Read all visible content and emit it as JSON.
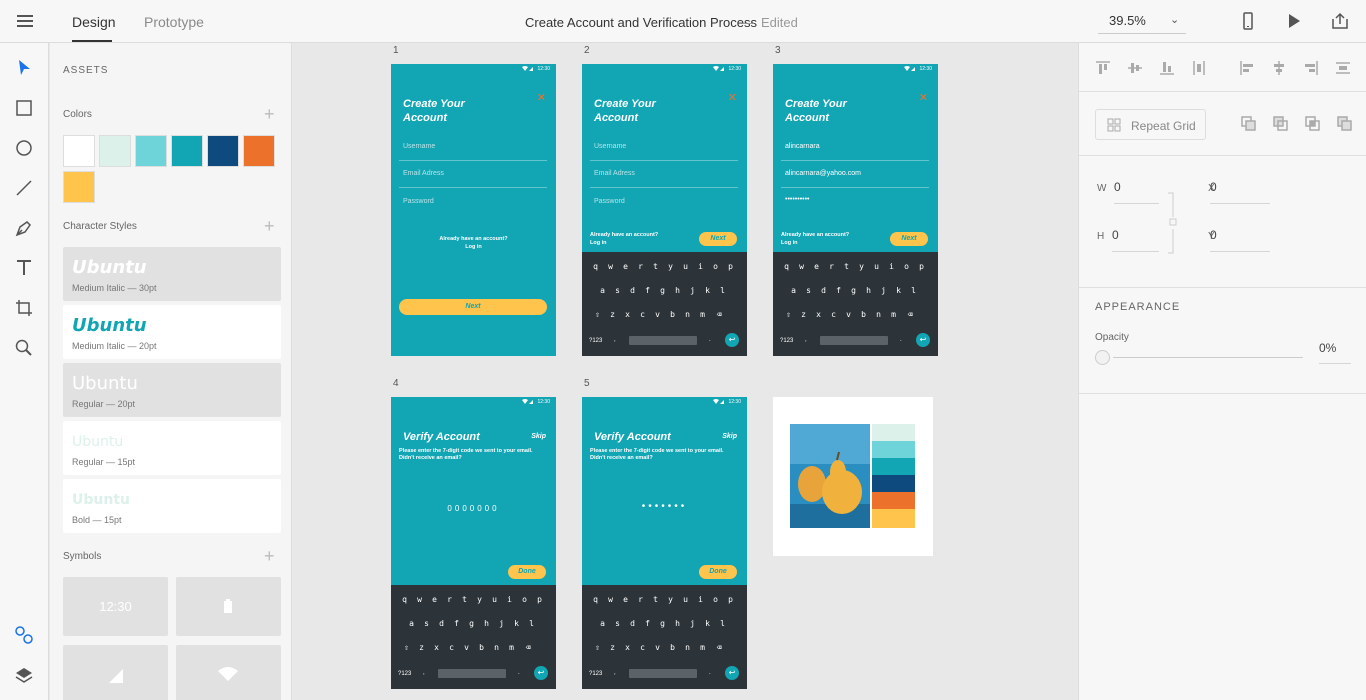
{
  "header": {
    "menu_icon": "hamburger-icon",
    "tabs": [
      {
        "label": "Design",
        "active": true
      },
      {
        "label": "Prototype",
        "active": false
      }
    ],
    "document_title": "Create Account and Verification Process",
    "separator": "—",
    "status": "Edited",
    "zoom": "39.5%",
    "icons": [
      "mobile-preview-icon",
      "play-icon",
      "share-icon"
    ]
  },
  "toolbar": {
    "tools": [
      "select-tool-icon",
      "rectangle-tool-icon",
      "ellipse-tool-icon",
      "line-tool-icon",
      "pen-tool-icon",
      "text-tool-icon",
      "artboard-tool-icon",
      "zoom-tool-icon"
    ],
    "bottom": [
      "assets-icon",
      "layers-icon"
    ]
  },
  "assets": {
    "title": "ASSETS",
    "colors_label": "Colors",
    "colors": [
      "#ffffff",
      "#dcf1ea",
      "#6fd3da",
      "#12a5b3",
      "#0e4a7e",
      "#ec722c",
      "#ffc44c"
    ],
    "character_styles_label": "Character Styles",
    "character_styles": [
      {
        "name": "Ubuntu",
        "desc": "Medium Italic — 30pt"
      },
      {
        "name": "Ubuntu",
        "desc": "Medium Italic — 20pt"
      },
      {
        "name": "Ubuntu",
        "desc": "Regular — 20pt"
      },
      {
        "name": "Ubuntu",
        "desc": "Regular — 15pt"
      },
      {
        "name": "Ubuntu",
        "desc": "Bold — 15pt"
      }
    ],
    "symbols_label": "Symbols",
    "symbols": [
      {
        "label": "12:30"
      },
      {
        "label": ""
      },
      {
        "label": ""
      },
      {
        "label": ""
      }
    ]
  },
  "artboards": {
    "numbers": [
      "1",
      "2",
      "3",
      "4",
      "5"
    ],
    "status_time": "12:30",
    "create_title_line1": "Create Your",
    "create_title_line2": "Account",
    "fields": {
      "username": "Username",
      "email": "Email Adress",
      "password": "Password",
      "username_value": "alincarnara",
      "email_value": "alincarnara@yahoo.com",
      "password_value": "••••••••••"
    },
    "already_line1": "Already have an account?",
    "already_line2": "Log in",
    "next": "Next",
    "verify_title": "Verify Account",
    "skip": "Skip",
    "verify_sub": "Please enter the 7-digit code we sent to your email. Didn't receive an email?",
    "code_empty": "0000000",
    "code_filled": "•••••••",
    "done": "Done",
    "keyboard": {
      "row1": [
        "q",
        "w",
        "e",
        "r",
        "t",
        "y",
        "u",
        "i",
        "o",
        "p"
      ],
      "row2": [
        "a",
        "s",
        "d",
        "f",
        "g",
        "h",
        "j",
        "k",
        "l"
      ],
      "row3": [
        "z",
        "x",
        "c",
        "v",
        "b",
        "n",
        "m"
      ],
      "num": "?123",
      "comma": ",",
      "period": "."
    }
  },
  "properties": {
    "repeat_grid": "Repeat Grid",
    "w_label": "W",
    "w_value": "0",
    "h_label": "H",
    "h_value": "0",
    "x_label": "X",
    "x_value": "0",
    "y_label": "Y",
    "y_value": "0",
    "appearance": "APPEARANCE",
    "opacity_label": "Opacity",
    "opacity_value": "0%"
  }
}
